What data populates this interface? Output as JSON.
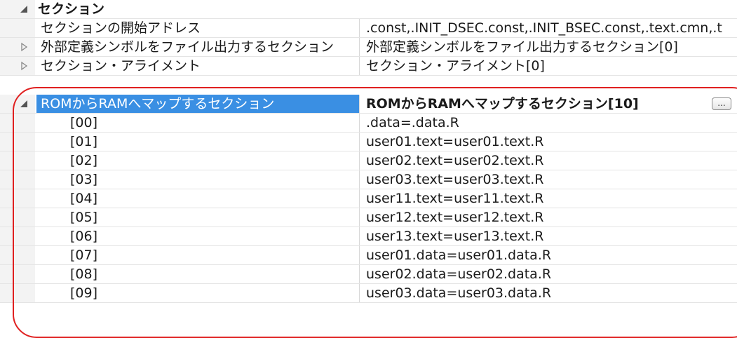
{
  "grid": {
    "category": {
      "label": "セクション",
      "expander_icon": "triangle-down-icon"
    },
    "rows": [
      {
        "name": "セクションの開始アドレス",
        "value": ".const,.INIT_DSEC.const,.INIT_BSEC.const,.text.cmn,.t",
        "expander": null
      },
      {
        "name": "外部定義シンボルをファイル出力するセクション",
        "value": "外部定義シンボルをファイル出力するセクション[0]",
        "expander": "triangle-right-icon"
      },
      {
        "name": "セクション・アライメント",
        "value": "セクション・アライメント[0]",
        "expander": "triangle-right-icon"
      },
      {
        "name": "ROMからRAMへマップするセクション",
        "value": "ROMからRAMへマップするセクション[10]",
        "expander": "triangle-down-icon",
        "selected": true,
        "button_label": "..."
      }
    ],
    "children": [
      {
        "index": "[00]",
        "value": ".data=.data.R"
      },
      {
        "index": "[01]",
        "value": "user01.text=user01.text.R"
      },
      {
        "index": "[02]",
        "value": "user02.text=user02.text.R"
      },
      {
        "index": "[03]",
        "value": "user03.text=user03.text.R"
      },
      {
        "index": "[04]",
        "value": "user11.text=user11.text.R"
      },
      {
        "index": "[05]",
        "value": "user12.text=user12.text.R"
      },
      {
        "index": "[06]",
        "value": "user13.text=user13.text.R"
      },
      {
        "index": "[07]",
        "value": "user01.data=user01.data.R"
      },
      {
        "index": "[08]",
        "value": "user02.data=user02.data.R"
      },
      {
        "index": "[09]",
        "value": "user03.data=user03.data.R"
      }
    ]
  },
  "colors": {
    "selection": "#3a8fe3",
    "highlight_frame": "#e02020",
    "gutter": "#f3f3f3"
  }
}
